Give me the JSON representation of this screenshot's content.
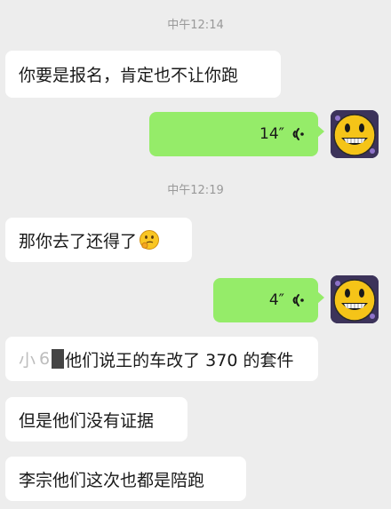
{
  "chat": {
    "timestamps": [
      "中午12:14",
      "中午12:19"
    ],
    "messages": [
      {
        "side": "incoming",
        "text": "你要是报名，肯定也不让你跑"
      },
      {
        "side": "outgoing",
        "type": "voice",
        "duration": "14″"
      },
      {
        "side": "incoming",
        "text": "那你去了还得了",
        "emoji": "thinking-face"
      },
      {
        "side": "outgoing",
        "type": "voice",
        "duration": "4″"
      },
      {
        "side": "incoming",
        "text_prefix": "小",
        "text_faint": "6",
        "text": "他们说王的车改了 370 的套件",
        "redacted": true
      },
      {
        "side": "incoming",
        "text": "但是他们没有证据"
      },
      {
        "side": "incoming",
        "text": "李宗他们这次也都是陪跑"
      }
    ]
  },
  "colors": {
    "background": "#ededed",
    "incoming_bubble": "#ffffff",
    "outgoing_bubble": "#95ec69",
    "timestamp_text": "#999999"
  },
  "icons": {
    "voice": "voice-wave-icon",
    "avatar": "smiley-face-avatar",
    "emoji": "thinking-face-emoji"
  }
}
